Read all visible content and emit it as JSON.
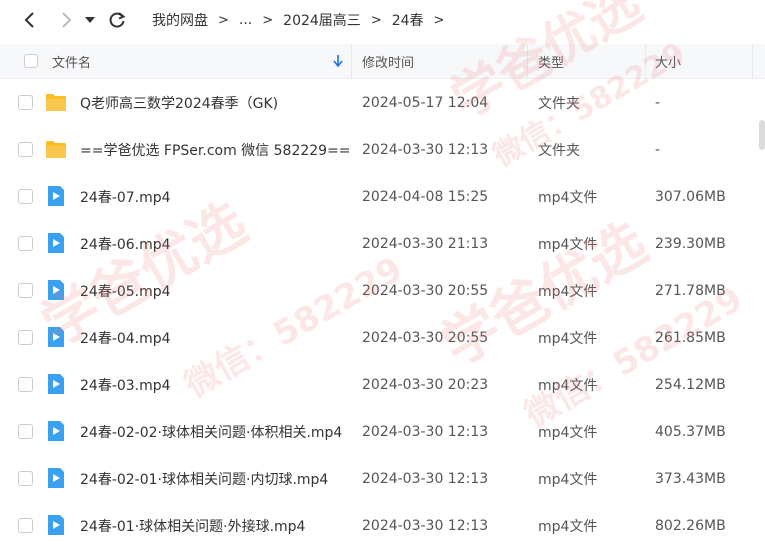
{
  "nav": {
    "breadcrumbs": [
      "我的网盘",
      "...",
      "2024届高三",
      "24春"
    ]
  },
  "header": {
    "name": "文件名",
    "time": "修改时间",
    "type": "类型",
    "size": "大小"
  },
  "watermark": {
    "text1": "学爸优选",
    "text2": "微信：582229"
  },
  "files": [
    {
      "name": "Q老师高三数学2024春季（GK)",
      "time": "2024-05-17 12:04",
      "type": "文件夹",
      "size": "-",
      "icon": "folder-icon"
    },
    {
      "name": "==学爸优选 FPSer.com 微信 582229==",
      "time": "2024-03-30 12:13",
      "type": "文件夹",
      "size": "-",
      "icon": "folder-icon"
    },
    {
      "name": "24春-07.mp4",
      "time": "2024-04-08 15:25",
      "type": "mp4文件",
      "size": "307.06MB",
      "icon": "video-file-icon"
    },
    {
      "name": "24春-06.mp4",
      "time": "2024-03-30 21:13",
      "type": "mp4文件",
      "size": "239.30MB",
      "icon": "video-file-icon"
    },
    {
      "name": "24春-05.mp4",
      "time": "2024-03-30 20:55",
      "type": "mp4文件",
      "size": "271.78MB",
      "icon": "video-file-icon"
    },
    {
      "name": "24春-04.mp4",
      "time": "2024-03-30 20:55",
      "type": "mp4文件",
      "size": "261.85MB",
      "icon": "video-file-icon"
    },
    {
      "name": "24春-03.mp4",
      "time": "2024-03-30 20:23",
      "type": "mp4文件",
      "size": "254.12MB",
      "icon": "video-file-icon"
    },
    {
      "name": "24春-02-02·球体相关问题·体积相关.mp4",
      "time": "2024-03-30 12:13",
      "type": "mp4文件",
      "size": "405.37MB",
      "icon": "video-file-icon"
    },
    {
      "name": "24春-02-01·球体相关问题·内切球.mp4",
      "time": "2024-03-30 12:13",
      "type": "mp4文件",
      "size": "373.43MB",
      "icon": "video-file-icon"
    },
    {
      "name": "24春-01·球体相关问题·外接球.mp4",
      "time": "2024-03-30 12:13",
      "type": "mp4文件",
      "size": "802.26MB",
      "icon": "video-file-icon"
    }
  ]
}
